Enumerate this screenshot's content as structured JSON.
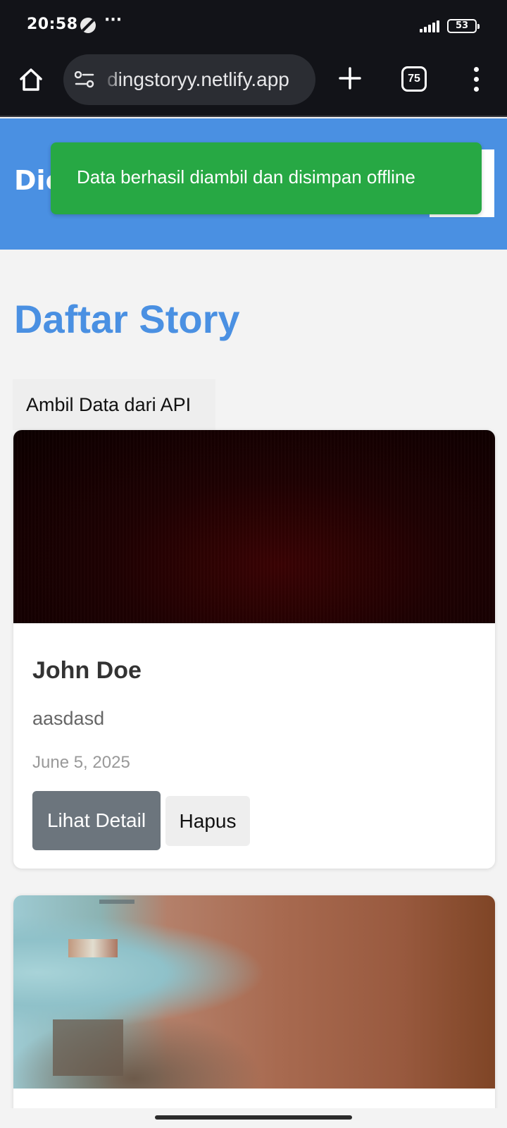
{
  "status_bar": {
    "time": "20:58",
    "more": "···",
    "battery": "53",
    "icons": [
      "app-notification-icon",
      "signal-icon",
      "battery-icon"
    ]
  },
  "browser": {
    "url": "dingstoryy.netlify.app",
    "tab_count": "75",
    "icons": [
      "home-icon",
      "site-settings-icon",
      "plus-icon",
      "tabs-icon",
      "more-vert-icon"
    ]
  },
  "header": {
    "brand": "Dicoding Story",
    "color": "#4a90e2"
  },
  "toast": {
    "message": "Data berhasil diambil dan disimpan offline",
    "color": "#27a844"
  },
  "main": {
    "title": "Daftar Story",
    "fetch_button": "Ambil Data dari API",
    "stories": [
      {
        "name": "John Doe",
        "description": "aasdasd",
        "date": "June 5, 2025",
        "detail_button": "Lihat Detail",
        "delete_button": "Hapus"
      }
    ]
  }
}
